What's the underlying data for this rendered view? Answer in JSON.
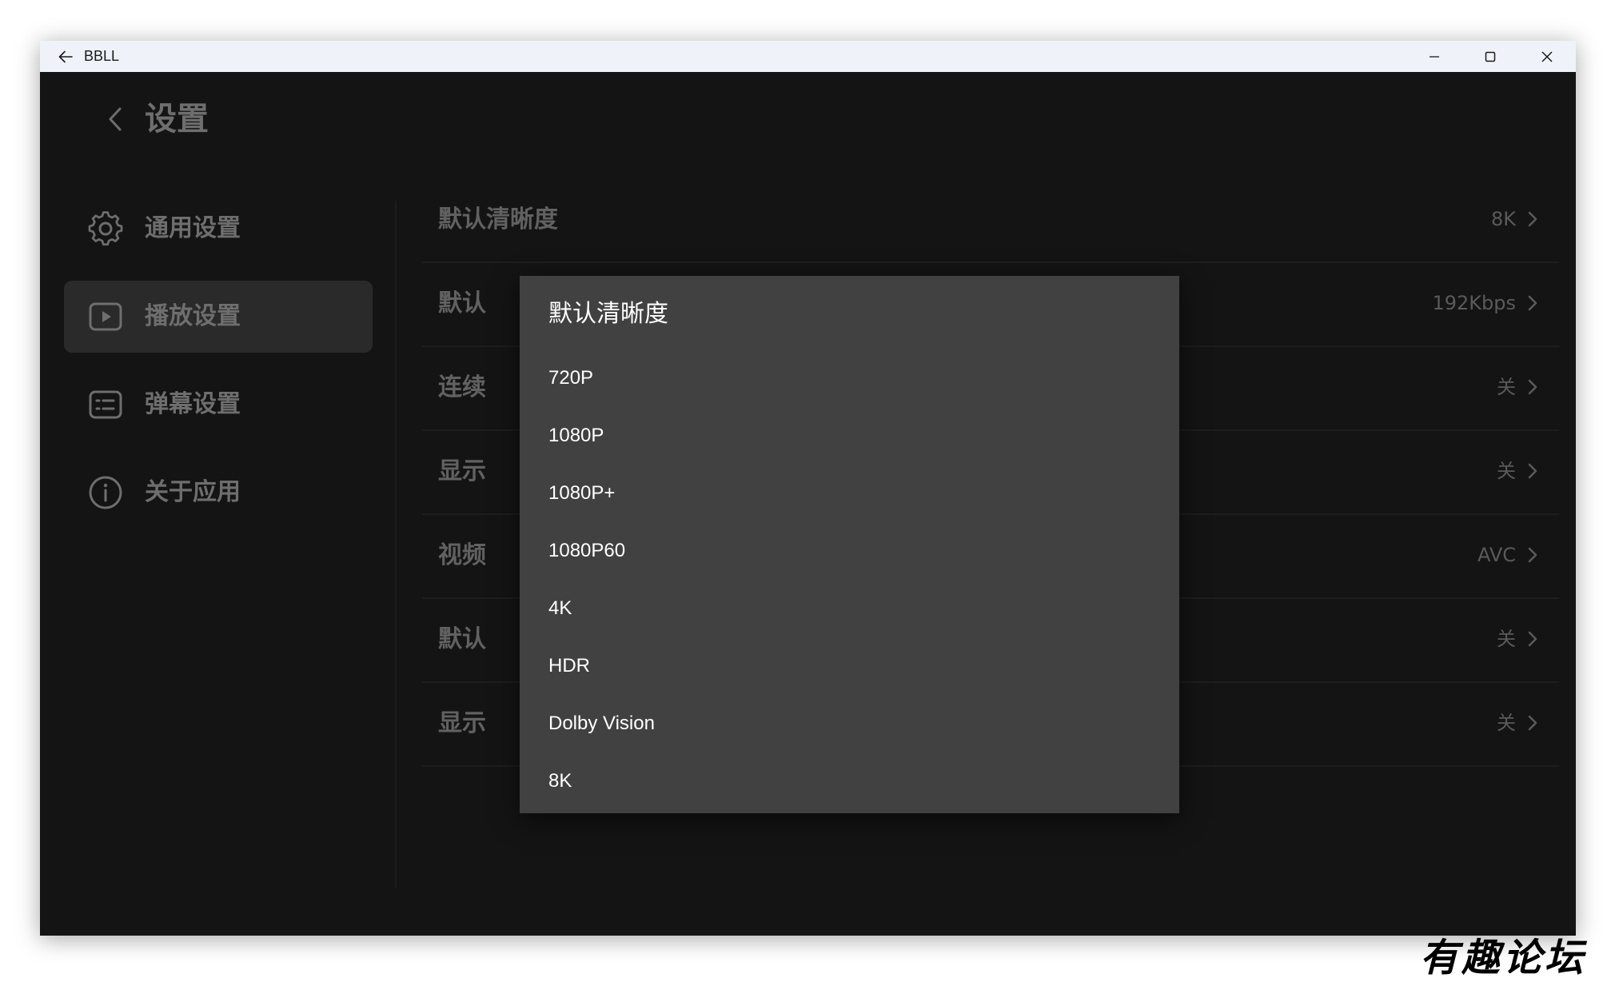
{
  "window": {
    "app_name": "BBLL",
    "controls": {
      "minimize": "minimize",
      "maximize": "maximize",
      "close": "close"
    }
  },
  "header": {
    "title": "设置"
  },
  "sidebar": {
    "items": [
      {
        "label": "通用设置",
        "icon": "gear-icon",
        "active": false
      },
      {
        "label": "播放设置",
        "icon": "play-icon",
        "active": true
      },
      {
        "label": "弹幕设置",
        "icon": "danmaku-icon",
        "active": false
      },
      {
        "label": "关于应用",
        "icon": "info-icon",
        "active": false
      }
    ]
  },
  "settings": {
    "rows": [
      {
        "label": "默认清晰度",
        "value": "8K"
      },
      {
        "label": "默认",
        "value": "192Kbps"
      },
      {
        "label": "连续",
        "value": "关"
      },
      {
        "label": "显示",
        "value": "关"
      },
      {
        "label": "视频",
        "value": "AVC"
      },
      {
        "label": "默认",
        "value": "关"
      },
      {
        "label": "显示",
        "value": "关"
      }
    ]
  },
  "dialog": {
    "title": "默认清晰度",
    "options": [
      "720P",
      "1080P",
      "1080P+",
      "1080P60",
      "4K",
      "HDR",
      "Dolby Vision",
      "8K"
    ]
  },
  "watermark": {
    "text": "有趣论坛"
  },
  "colors": {
    "background": "#141414",
    "titlebar": "#eff3f9",
    "dialog": "#414141",
    "active_nav": "#2a2a2a",
    "muted_text": "#6e6e6e"
  }
}
